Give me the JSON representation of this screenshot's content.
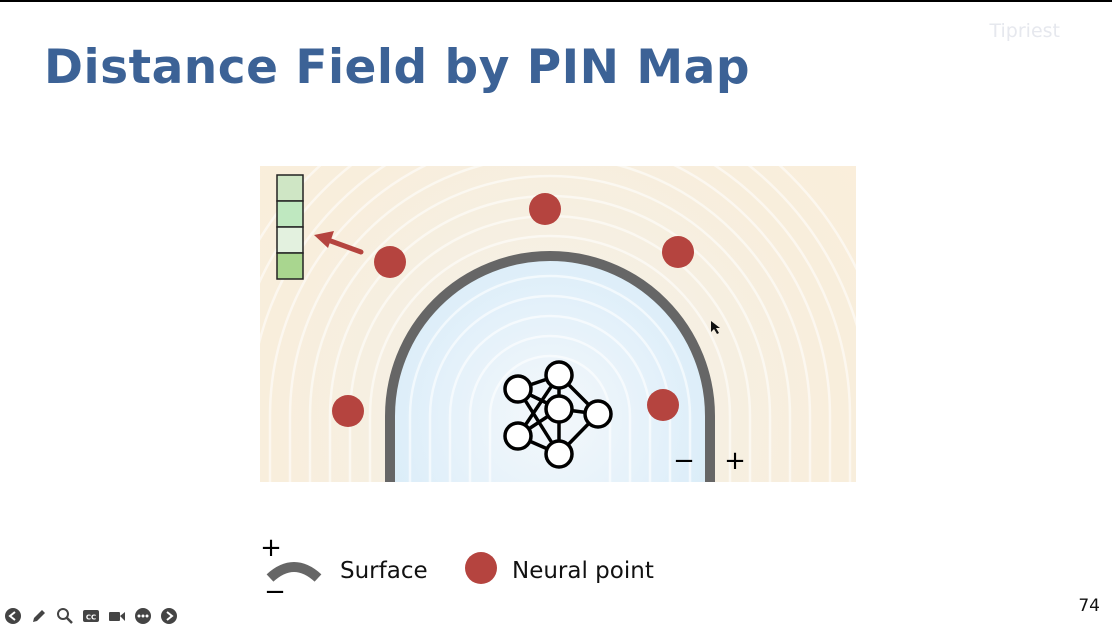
{
  "slide": {
    "title": "Distance Field by PIN Map",
    "watermark": "Tipriest",
    "page_number": "74"
  },
  "figure": {
    "inside_sign": "−",
    "outside_sign": "+",
    "colors": {
      "outside_field": "#fbeedb",
      "inside_field": "#e2f1fb",
      "surface": "#666666",
      "neural_point": "#b5443f",
      "feature_cells": [
        "#cfe6c5",
        "#bfe8c0",
        "#e3f1df",
        "#a9d68f"
      ]
    }
  },
  "legend": {
    "surface_plus": "+",
    "surface_minus": "−",
    "surface_label": "Surface",
    "point_label": "Neural point"
  },
  "toolbar": {
    "buttons": [
      "previous-icon",
      "pen-icon",
      "zoom-icon",
      "captions-icon",
      "camera-icon",
      "more-icon",
      "next-icon"
    ]
  }
}
